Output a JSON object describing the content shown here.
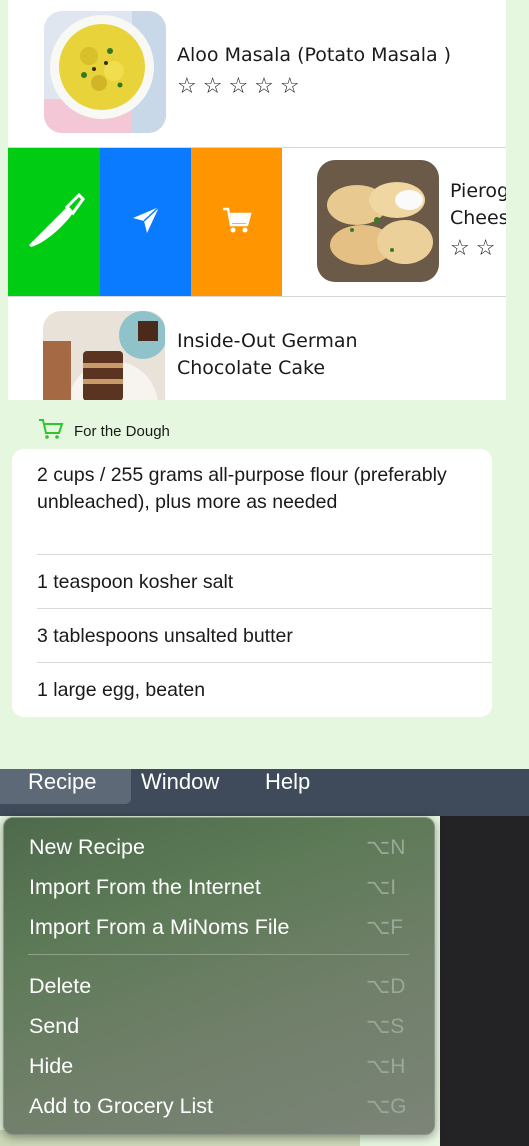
{
  "recipes": [
    {
      "title": "Aloo Masala (Potato Masala )",
      "stars": "☆☆☆☆☆"
    },
    {
      "title_line1": "Pierog",
      "title_line2": "Chees",
      "stars": "☆☆"
    },
    {
      "title_line1": "Inside-Out German",
      "title_line2": "Chocolate Cake"
    }
  ],
  "swipe_actions": [
    {
      "icon": "knife-icon",
      "color": "#00cc14"
    },
    {
      "icon": "send-icon",
      "color": "#0a7bff"
    },
    {
      "icon": "cart-icon",
      "color": "#ff9500"
    }
  ],
  "grocery": {
    "section_title": "For the Dough",
    "accent": "#2fc52f",
    "items": [
      "2 cups / 255 grams all-purpose flour (preferably unbleached), plus more as needed",
      "1 teaspoon kosher salt",
      "3 tablespoons unsalted butter",
      "1 large egg, beaten"
    ]
  },
  "menubar": {
    "items": [
      "Recipe",
      "Window",
      "Help"
    ],
    "selected": "Recipe"
  },
  "menu": {
    "items": [
      {
        "label": "New Recipe",
        "shortcut": "⌥N"
      },
      {
        "label": "Import From the Internet",
        "shortcut": "⌥I"
      },
      {
        "label": "Import From a MiNoms File",
        "shortcut": "⌥F"
      },
      {
        "label": "Delete",
        "shortcut": "⌥D"
      },
      {
        "label": "Send",
        "shortcut": "⌥S"
      },
      {
        "label": "Hide",
        "shortcut": "⌥H"
      },
      {
        "label": "Add to Grocery List",
        "shortcut": "⌥G"
      }
    ]
  }
}
